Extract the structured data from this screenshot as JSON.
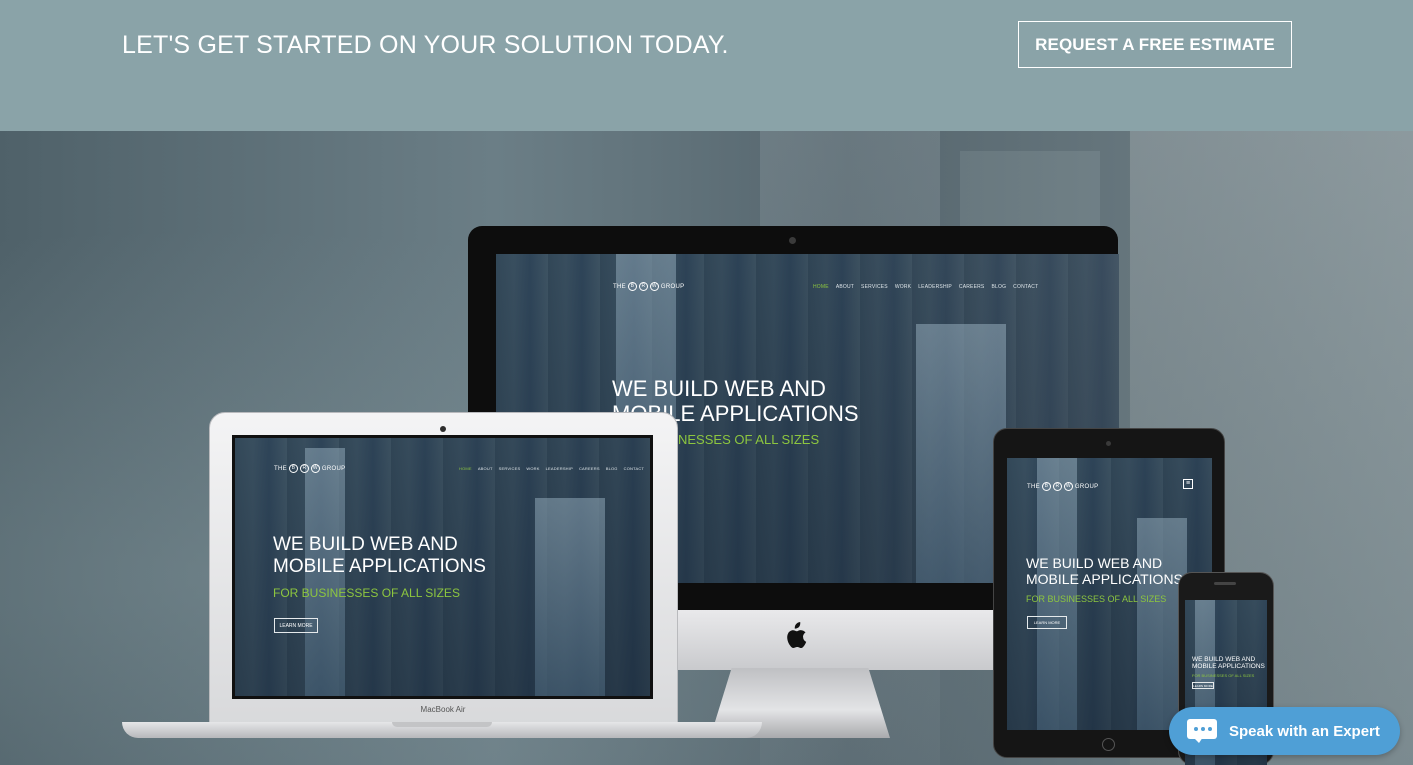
{
  "cta": {
    "headline": "LET'S GET STARTED ON YOUR SOLUTION TODAY.",
    "button_label": "REQUEST A FREE ESTIMATE"
  },
  "mock_site": {
    "logo_prefix": "THE",
    "logo_letters": [
      "B",
      "R",
      "W"
    ],
    "logo_suffix": "GROUP",
    "nav": [
      "HOME",
      "ABOUT",
      "SERVICES",
      "WORK",
      "LEADERSHIP",
      "CAREERS",
      "BLOG",
      "CONTACT"
    ],
    "headline_line1": "WE BUILD WEB AND",
    "headline_line2": "MOBILE APPLICATIONS",
    "imac_sub_visible": "NESSES OF ALL SIZES",
    "subheadline": "FOR BUSINESSES OF ALL SIZES",
    "learn_more": "LEARN MORE"
  },
  "devices": {
    "laptop_label": "MacBook Air"
  },
  "chat": {
    "label": "Speak with an Expert"
  },
  "colors": {
    "banner_bg": "#8aa3a8",
    "accent_green": "#8dc63f",
    "chat_blue": "#4f9fd6"
  },
  "icons": {
    "apple": "apple-logo-icon",
    "chat": "chat-bubble-icon",
    "menu": "hamburger-menu-icon"
  }
}
